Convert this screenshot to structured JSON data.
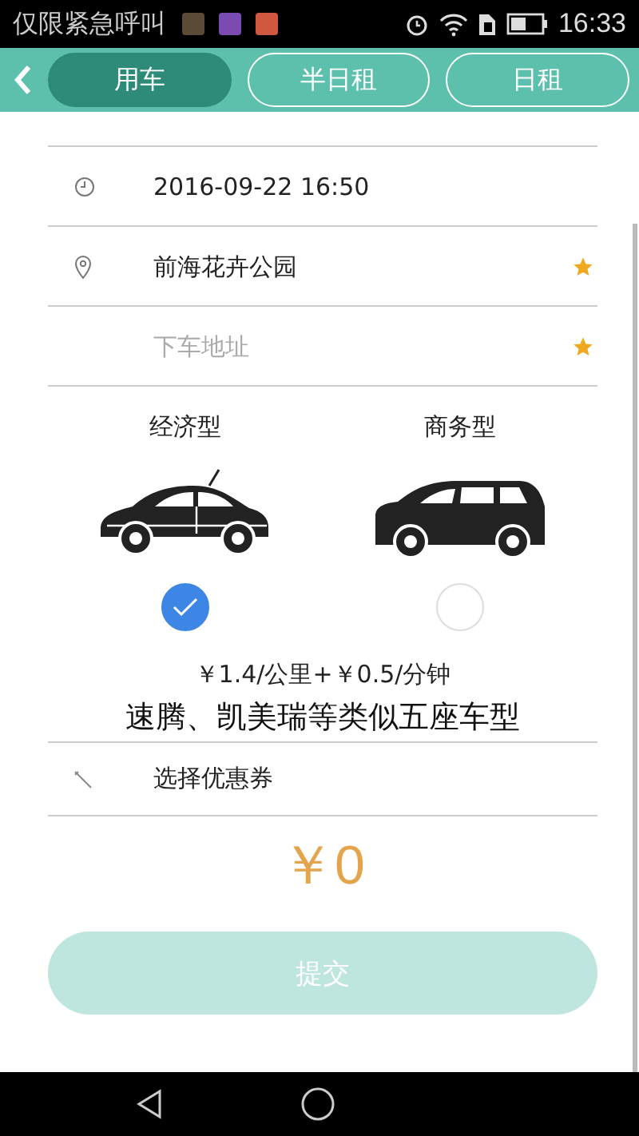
{
  "status_bar": {
    "carrier": "仅限紧急呼叫",
    "time": "16:33"
  },
  "header": {
    "tabs": [
      {
        "label": "用车",
        "selected": true
      },
      {
        "label": "半日租",
        "selected": false
      },
      {
        "label": "日租",
        "selected": false
      }
    ]
  },
  "trip": [
    {
      "kind": "time",
      "value": "2016-09-22 16:50",
      "required": false
    },
    {
      "kind": "location",
      "value": "前海花卉公园",
      "required": true
    },
    {
      "kind": "blank",
      "placeholder": "下车地址",
      "required": true
    }
  ],
  "car_types": [
    {
      "kind": "sedan",
      "label": "经济型",
      "selected": true
    },
    {
      "kind": "van",
      "label": "商务型",
      "selected": false
    }
  ],
  "rate": "￥1.4/公里+￥0.5/分钟",
  "models": "速腾、凯美瑞等类似五座车型",
  "coupon": "选择优惠券",
  "total": "￥0",
  "submit": {
    "label": "提交",
    "disabled": true
  }
}
